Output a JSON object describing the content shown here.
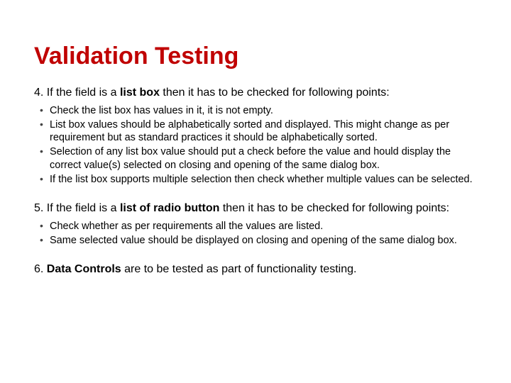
{
  "title": "Validation Testing",
  "section4": {
    "prefix": "4. If the field is a ",
    "bold": "list box",
    "suffix": " then it has to be checked for following points:",
    "bullets": [
      "Check the list box has values in it, it is not empty.",
      "List box values should be alphabetically sorted and displayed. This might change as per requirement but as standard practices it should be alphabetically sorted.",
      "Selection of any list box value should put a check before the value and hould display the correct value(s) selected on closing and opening of the same dialog box.",
      "If the list box supports multiple selection then check whether multiple values can be selected."
    ]
  },
  "section5": {
    "prefix": "5. If the field is a ",
    "bold": "list of radio button",
    "suffix": " then it has to be checked for following points:",
    "bullets": [
      "Check whether as per requirements all the values are listed.",
      "Same selected value should be displayed on closing and opening of the same dialog box."
    ]
  },
  "section6": {
    "prefix": "6. ",
    "bold": "Data Controls",
    "suffix": " are to be tested as part of functionality testing."
  }
}
